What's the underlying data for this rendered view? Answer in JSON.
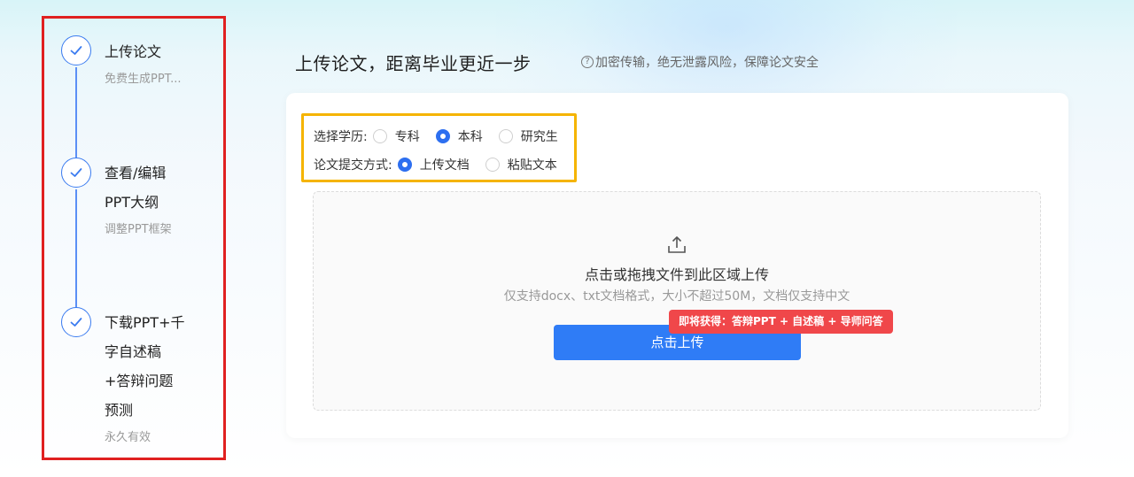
{
  "steps": [
    {
      "title": "上传论文",
      "sub": "免费生成PPT..."
    },
    {
      "title_lines": [
        "查看/编辑",
        "PPT大纲"
      ],
      "sub": "调整PPT框架"
    },
    {
      "title_lines": [
        "下载PPT+千",
        "字自述稿",
        "+答辩问题",
        "预测"
      ],
      "sub": "永久有效"
    }
  ],
  "header": {
    "title": "上传论文，距离毕业更近一步",
    "security_icon": "?",
    "security_note": "加密传输，绝无泄露风险，保障论文安全"
  },
  "options": {
    "education": {
      "label": "选择学历:",
      "choices": [
        "专科",
        "本科",
        "研究生"
      ],
      "selected": "本科"
    },
    "submit_method": {
      "label": "论文提交方式:",
      "choices": [
        "上传文档",
        "粘贴文本"
      ],
      "selected": "上传文档"
    }
  },
  "dropzone": {
    "title": "点击或拖拽文件到此区域上传",
    "hint": "仅支持docx、txt文档格式，大小不超过50M，文档仅支持中文",
    "button_label": "点击上传",
    "promo_badge": "即将获得：答辩PPT + 自述稿 + 导师问答"
  },
  "colors": {
    "accent": "#2f7cf6",
    "step_border_highlight": "#e02020",
    "options_highlight": "#f5b400",
    "promo": "#f0474a"
  }
}
